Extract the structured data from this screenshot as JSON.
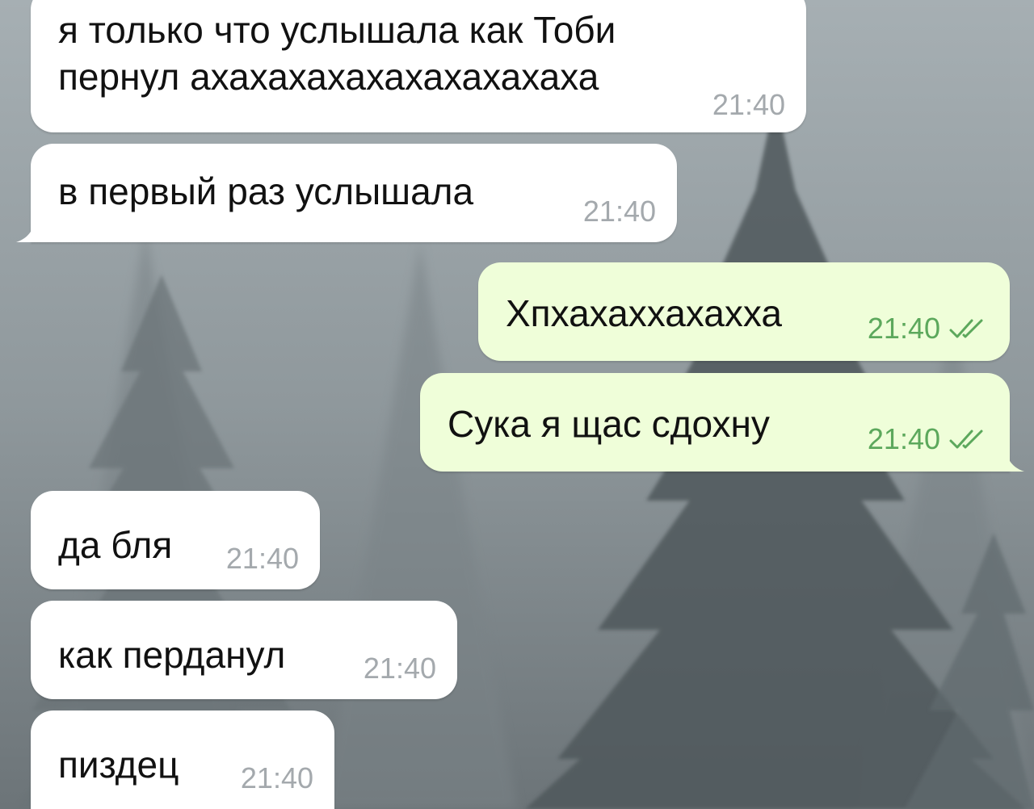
{
  "theme": {
    "incoming_bg": "#ffffff",
    "outgoing_bg": "#effed9",
    "incoming_time_color": "#a4a9ad",
    "outgoing_time_color": "#5ca85c"
  },
  "messages": [
    {
      "direction": "incoming",
      "text": "я только что услышала как Тоби\nпернул ахахахахахахахахахаха",
      "time": "21:40"
    },
    {
      "direction": "incoming",
      "text": "в первый раз услышала",
      "time": "21:40"
    },
    {
      "direction": "outgoing",
      "text": "Хпхахаххахахха",
      "time": "21:40",
      "status_icon": "double-check-icon"
    },
    {
      "direction": "outgoing",
      "text": "Сука я щас сдохну",
      "time": "21:40",
      "status_icon": "double-check-icon"
    },
    {
      "direction": "incoming",
      "text": "да бля",
      "time": "21:40"
    },
    {
      "direction": "incoming",
      "text": "как перданул",
      "time": "21:40"
    },
    {
      "direction": "incoming",
      "text": "пиздец",
      "time": "21:40"
    }
  ]
}
